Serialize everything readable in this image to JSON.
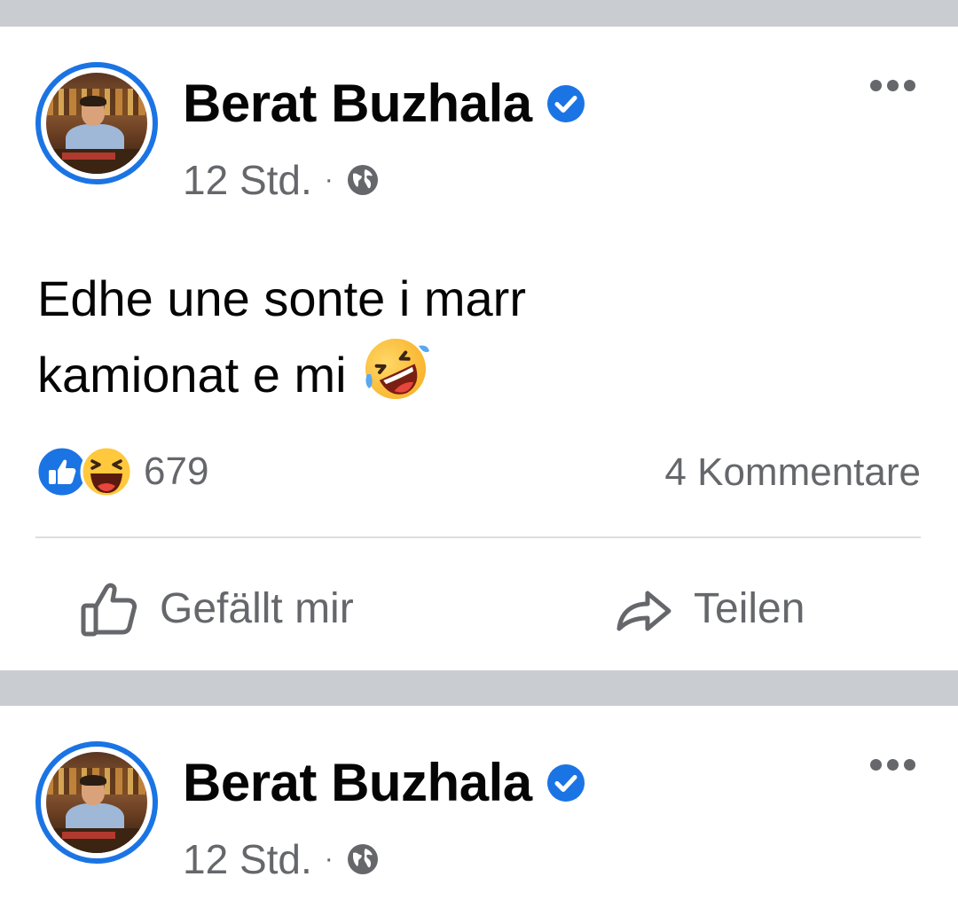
{
  "posts": [
    {
      "author": "Berat Buzhala",
      "time": "12 Std.",
      "separator": "·",
      "audience_icon": "globe-icon",
      "text_line1": "Edhe une sonte i marr",
      "text_line2": "kamionat e mi",
      "emoji": "rolling-on-floor-laughing",
      "reactions": [
        "like",
        "haha"
      ],
      "reaction_count": "679",
      "comments": "4 Kommentare",
      "like_label": "Gefällt mir",
      "share_label": "Teilen"
    },
    {
      "author": "Berat Buzhala",
      "time": "12 Std.",
      "separator": "·",
      "audience_icon": "globe-icon"
    }
  ],
  "colors": {
    "accent": "#1b74e4",
    "secondary_text": "#65676b",
    "separator": "#c9ccd1"
  }
}
